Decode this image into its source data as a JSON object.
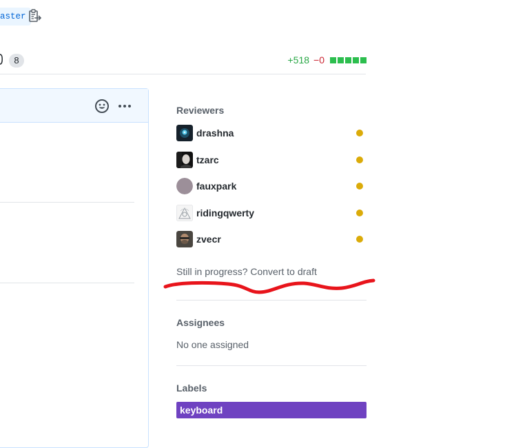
{
  "header": {
    "branch_fragment": "aster",
    "copy_icon": "clipboard-icon"
  },
  "tabs": {
    "files_count": "8",
    "diffstat": {
      "additions": "+518",
      "deletions": "−0",
      "blocks": 5,
      "block_color": "#2cbe4e"
    }
  },
  "comment": {
    "icons": [
      "smiley-icon",
      "kebab-horizontal-icon"
    ]
  },
  "sidebar": {
    "reviewers": {
      "heading": "Reviewers",
      "pending_color": "#dbab09",
      "items": [
        {
          "name": "drashna"
        },
        {
          "name": "tzarc"
        },
        {
          "name": "fauxpark"
        },
        {
          "name": "ridingqwerty"
        },
        {
          "name": "zvecr"
        }
      ]
    },
    "convert_link": "Still in progress? Convert to draft",
    "assignees": {
      "heading": "Assignees",
      "value": "No one assigned"
    },
    "labels": {
      "heading": "Labels",
      "items": [
        {
          "name": "keyboard",
          "color": "#6f42c1"
        }
      ]
    }
  },
  "annotation": {
    "color": "#e8141b"
  }
}
